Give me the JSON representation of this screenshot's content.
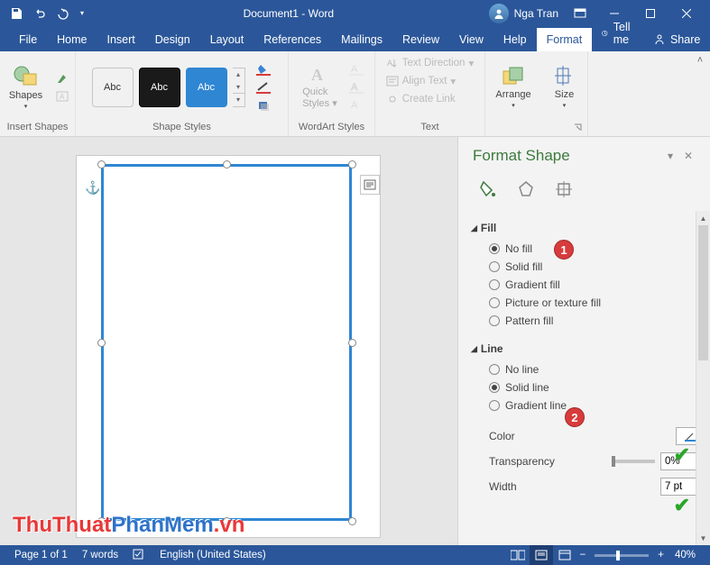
{
  "titlebar": {
    "title": "Document1 - Word",
    "user_name": "Nga Tran"
  },
  "tabs": {
    "file": "File",
    "home": "Home",
    "insert": "Insert",
    "design": "Design",
    "layout": "Layout",
    "references": "References",
    "mailings": "Mailings",
    "review": "Review",
    "view": "View",
    "help": "Help",
    "format": "Format",
    "tellme": "Tell me",
    "share": "Share"
  },
  "ribbon": {
    "insert_shapes": {
      "btn": "Shapes",
      "group": "Insert Shapes"
    },
    "shape_styles": {
      "group": "Shape Styles",
      "preview": "Abc"
    },
    "wordart": {
      "btn": "Quick Styles",
      "group": "WordArt Styles"
    },
    "text": {
      "group": "Text",
      "text_direction": "Text Direction",
      "align_text": "Align Text",
      "create_link": "Create Link"
    },
    "arrange": {
      "btn": "Arrange"
    },
    "size": {
      "btn": "Size"
    }
  },
  "format_shape": {
    "title": "Format Shape",
    "fill": {
      "header": "Fill",
      "no_fill": "No fill",
      "solid_fill": "Solid fill",
      "gradient_fill": "Gradient fill",
      "picture_fill": "Picture or texture fill",
      "pattern_fill": "Pattern fill",
      "selected": "no_fill"
    },
    "line": {
      "header": "Line",
      "no_line": "No line",
      "solid_line": "Solid line",
      "gradient_line": "Gradient line",
      "selected": "solid_line",
      "color_label": "Color",
      "color_value": "#2f86d3",
      "transparency_label": "Transparency",
      "transparency_value": "0%",
      "width_label": "Width",
      "width_value": "7 pt"
    },
    "callouts": {
      "one": "1",
      "two": "2"
    }
  },
  "statusbar": {
    "page": "Page 1 of 1",
    "words": "7 words",
    "language": "English (United States)",
    "zoom": "40%"
  },
  "watermark": {
    "a": "ThuThuat",
    "b": "PhanMem",
    "c": ".vn"
  }
}
